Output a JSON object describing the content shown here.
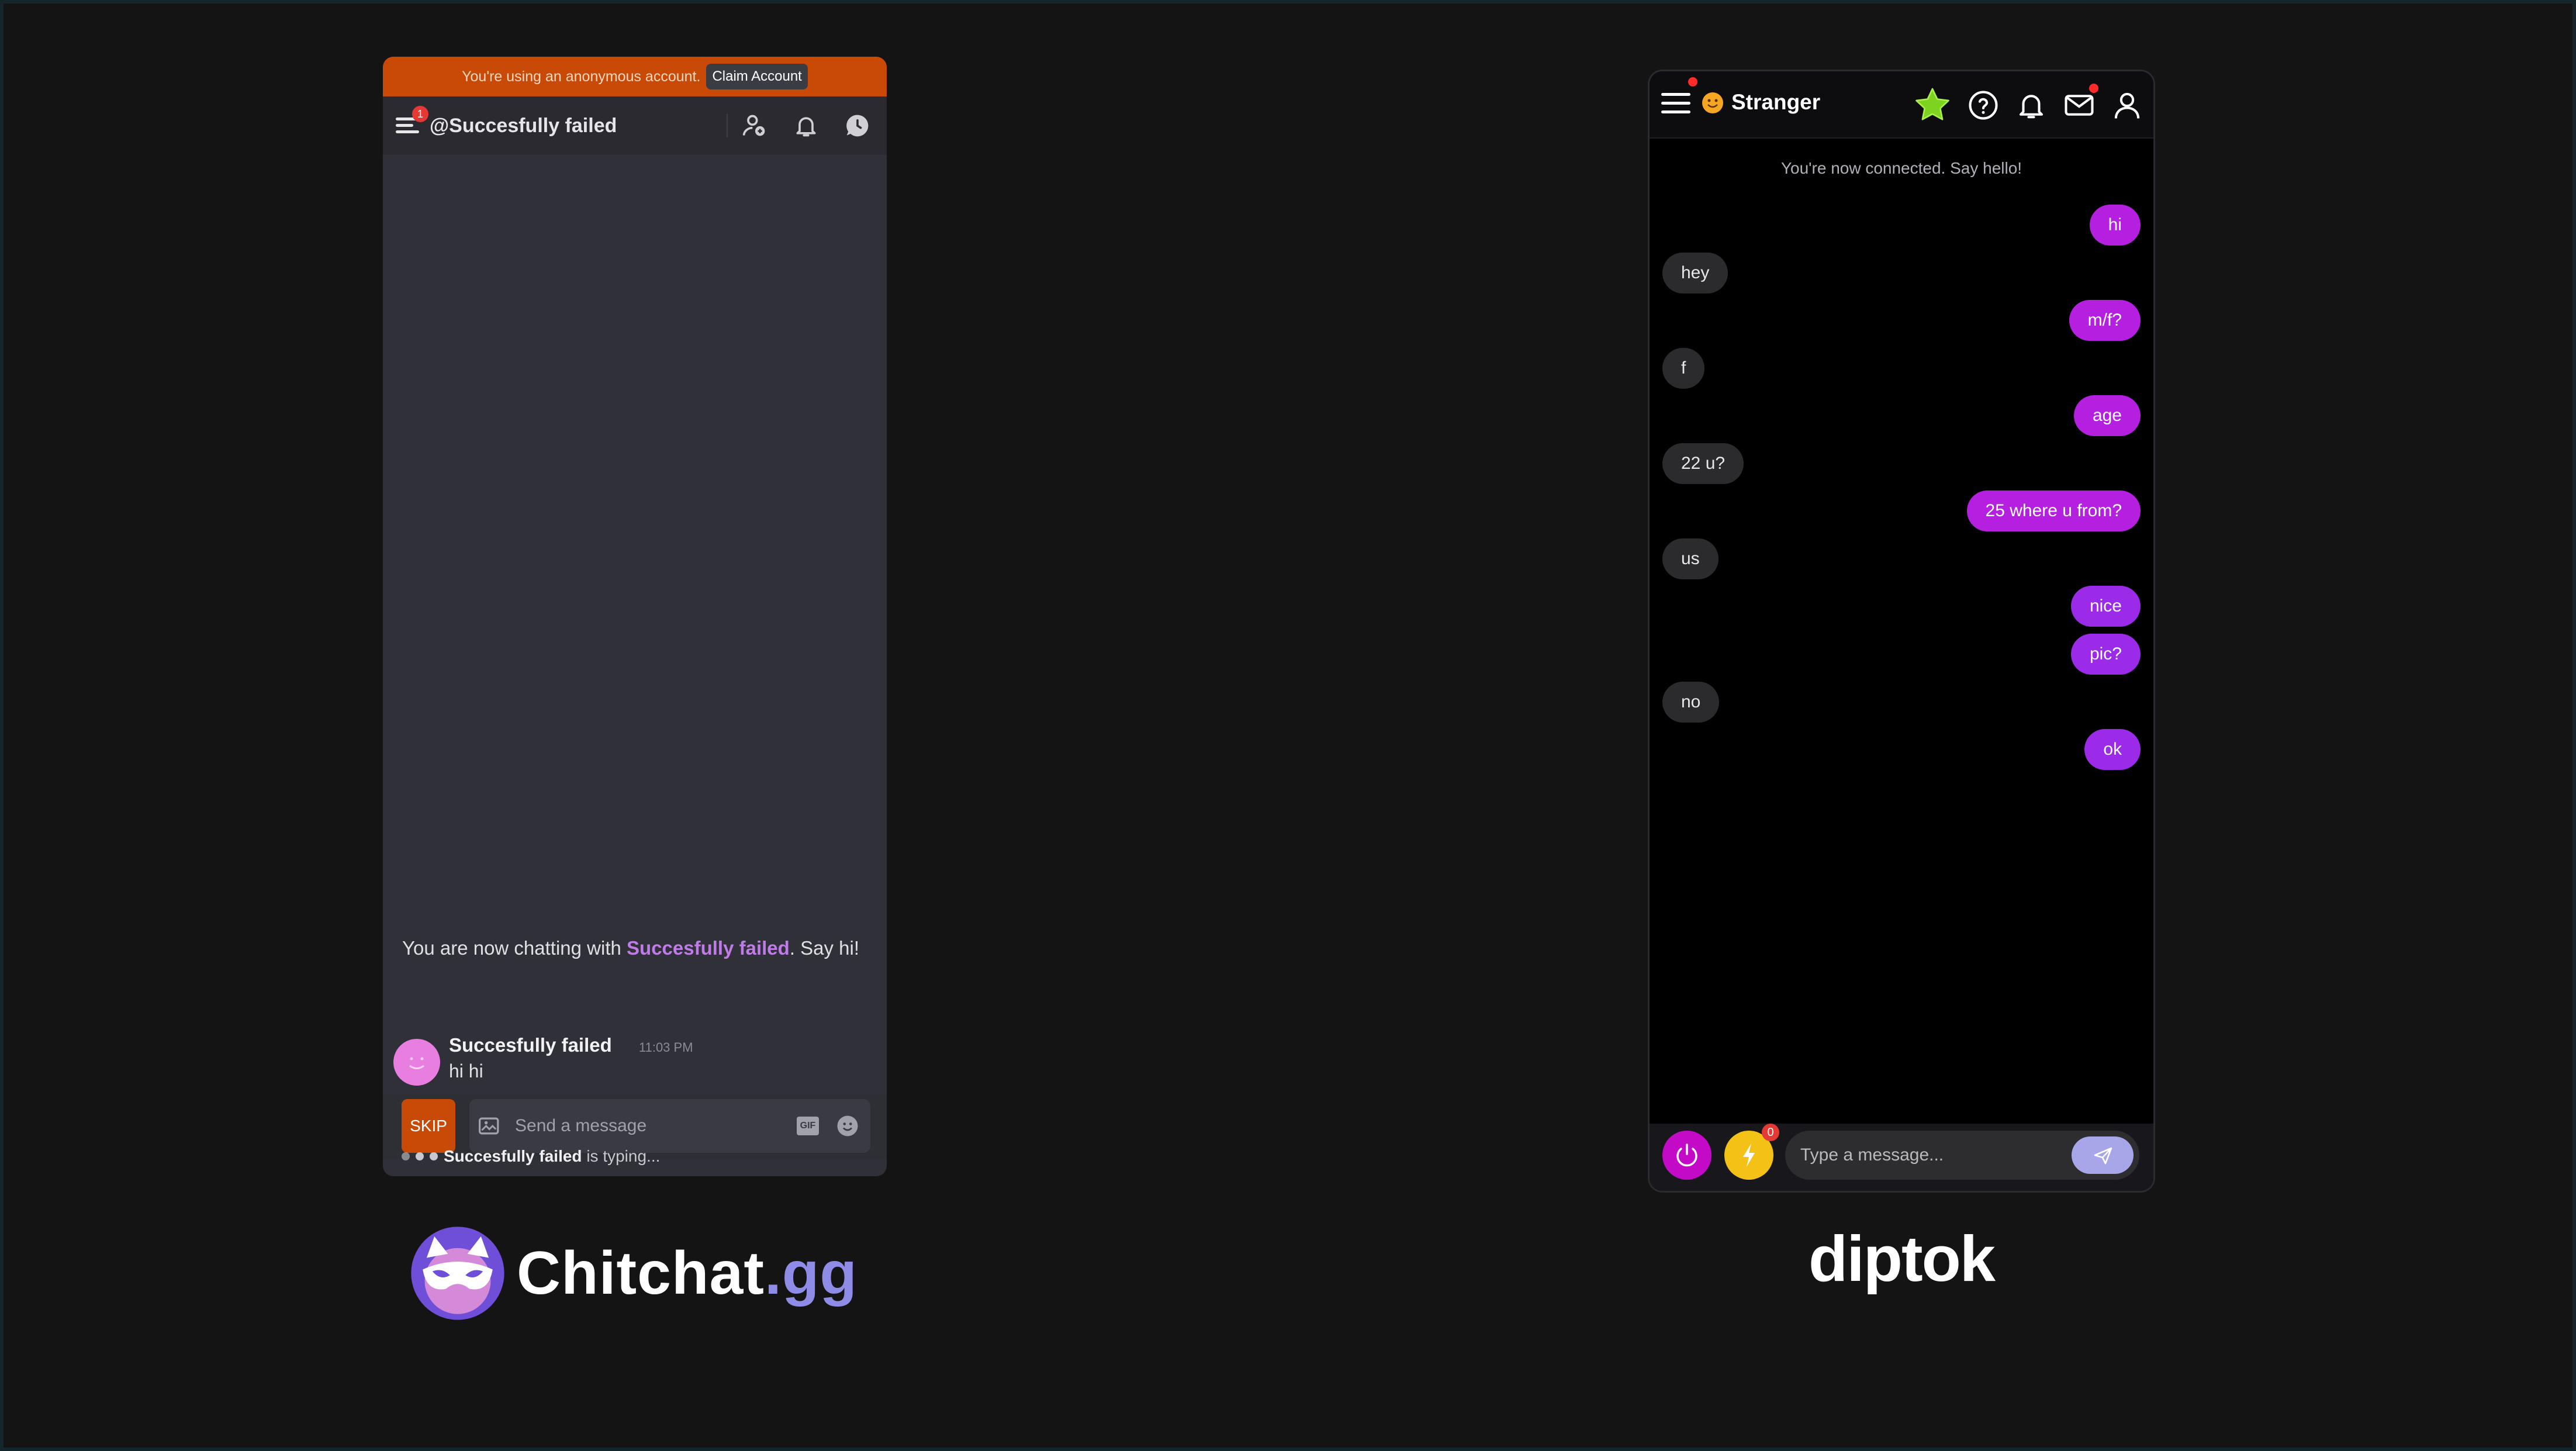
{
  "chitchat": {
    "banner_text": "You're using an anonymous account.",
    "claim_label": "Claim Account",
    "menu_badge": "1",
    "username": "@Succesfully failed",
    "chat_intro_pre": "You are now chatting with ",
    "chat_intro_name": "Succesfully failed",
    "chat_intro_post": ". Say hi!",
    "message": {
      "author": "Succesfully failed",
      "time": "11:03 PM",
      "text": "hi hi"
    },
    "skip_label": "SKIP",
    "input_placeholder": "Send a message",
    "gif_label": "GIF",
    "typing_name": "Succesfully failed",
    "typing_suffix": " is typing...",
    "logo_main": "Chitchat",
    "logo_suffix": ".gg",
    "colors": {
      "accent": "#c84a06",
      "highlight": "#bf7be6",
      "panel": "#303039"
    }
  },
  "diptok": {
    "title": "Stranger",
    "system_message": "You're now connected. Say hello!",
    "messages": [
      {
        "from": "me",
        "text": "hi"
      },
      {
        "from": "them",
        "text": "hey"
      },
      {
        "from": "me",
        "text": "m/f?"
      },
      {
        "from": "them",
        "text": "f"
      },
      {
        "from": "me",
        "text": "age"
      },
      {
        "from": "them",
        "text": "22 u?"
      },
      {
        "from": "me",
        "text": "25 where u from?"
      },
      {
        "from": "them",
        "text": "us"
      },
      {
        "from": "me",
        "text": "nice"
      },
      {
        "from": "me",
        "text": "pic?"
      },
      {
        "from": "them",
        "text": "no"
      },
      {
        "from": "me",
        "text": "ok"
      }
    ],
    "bolt_badge": "0",
    "input_placeholder": "Type a message...",
    "logo": "diptok",
    "colors": {
      "me_bubble": "#b41fe0",
      "them_bubble": "#2b2b2d",
      "star": "#7ed321"
    }
  }
}
